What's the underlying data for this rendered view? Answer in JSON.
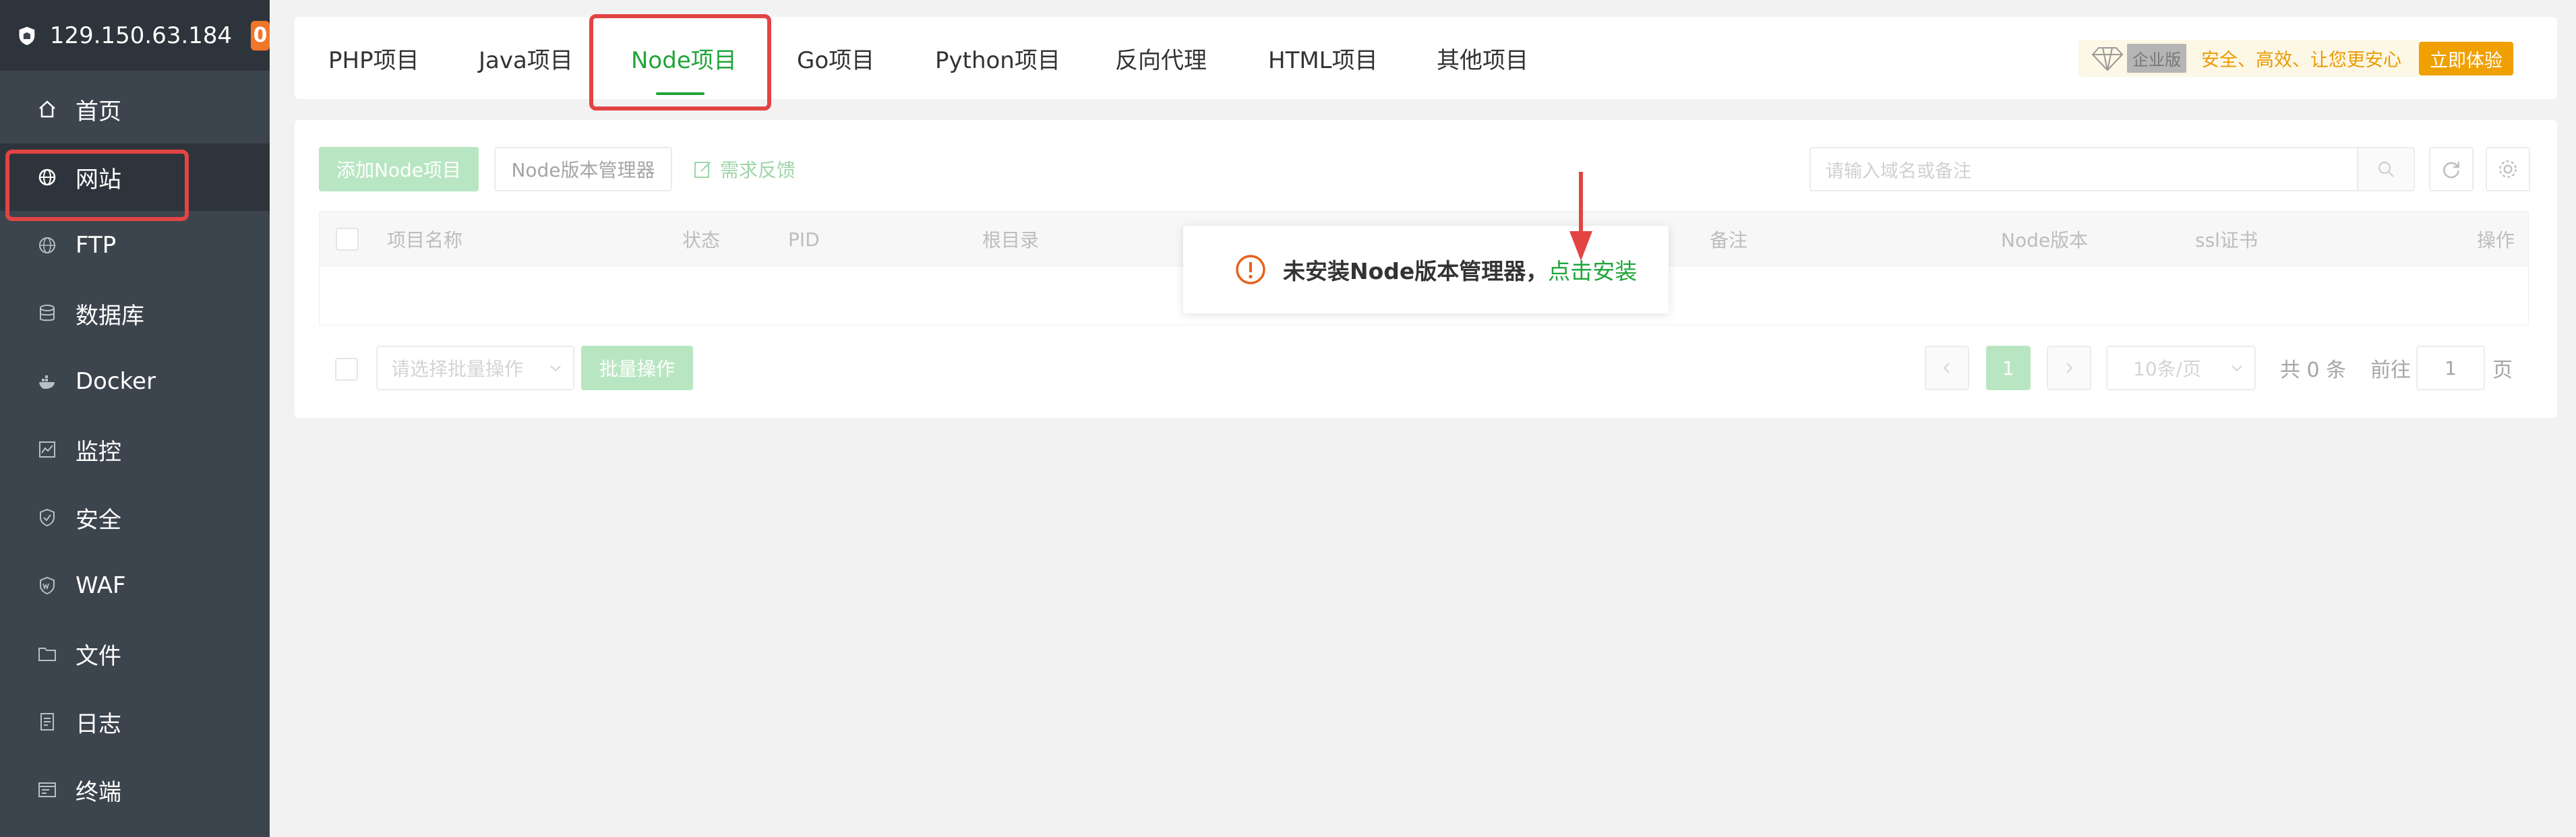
{
  "sidebar": {
    "server_ip": "129.150.63.184",
    "badge_count": "0",
    "items": [
      {
        "label": "首页",
        "icon": "home-icon"
      },
      {
        "label": "网站",
        "icon": "globe-icon"
      },
      {
        "label": "FTP",
        "icon": "ftp-globe-icon"
      },
      {
        "label": "数据库",
        "icon": "database-icon"
      },
      {
        "label": "Docker",
        "icon": "docker-icon"
      },
      {
        "label": "监控",
        "icon": "monitor-icon"
      },
      {
        "label": "安全",
        "icon": "shield-icon"
      },
      {
        "label": "WAF",
        "icon": "waf-shield-icon"
      },
      {
        "label": "文件",
        "icon": "folder-icon"
      },
      {
        "label": "日志",
        "icon": "log-icon"
      },
      {
        "label": "终端",
        "icon": "terminal-icon"
      }
    ],
    "active_item": "网站"
  },
  "tabs": {
    "items": [
      "PHP项目",
      "Java项目",
      "Node项目",
      "Go项目",
      "Python项目",
      "反向代理",
      "HTML项目",
      "其他项目"
    ],
    "active": "Node项目"
  },
  "promo": {
    "edition": "企业版",
    "slogan": "安全、高效、让您更安心",
    "button": "立即体验"
  },
  "toolbar": {
    "add_button": "添加Node项目",
    "version_manager_button": "Node版本管理器",
    "feedback_link": "需求反馈",
    "search_placeholder": "请输入域名或备注"
  },
  "table": {
    "columns": [
      "项目名称",
      "状态",
      "PID",
      "根目录",
      "备注",
      "Node版本",
      "ssl证书",
      "操作"
    ]
  },
  "footer": {
    "batch_select_placeholder": "请选择批量操作",
    "batch_button": "批量操作",
    "current_page": "1",
    "page_size": "10条/页",
    "total": "共 0 条",
    "goto_label": "前往",
    "goto_value": "1",
    "page_unit": "页"
  },
  "toast": {
    "message": "未安装Node版本管理器，",
    "link": "点击安装"
  },
  "colors": {
    "accent_green": "#20a53a",
    "highlight_red": "#e24444",
    "warning_orange": "#e8621b",
    "sidebar_bg": "#3c444d"
  }
}
